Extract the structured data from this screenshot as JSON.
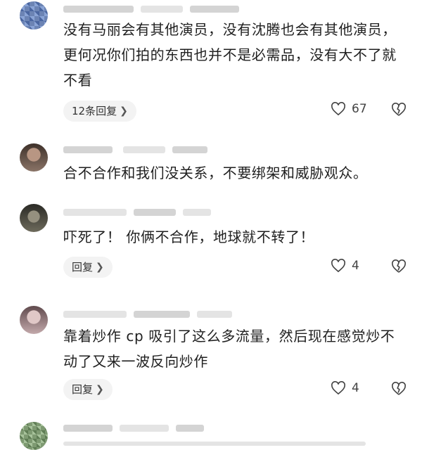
{
  "comments": [
    {
      "text": "没有马丽会有其他演员，没有沈腾也会有其他演员，更何况你们拍的东西也并不是必需品，没有大不了就不看",
      "reply_label": "12条回复",
      "likes": "67"
    },
    {
      "text": "合不合作和我们没关系，不要绑架和威胁观众。"
    },
    {
      "text": "吓死了！ 你俩不合作，地球就不转了！",
      "reply_label": "回复",
      "likes": "4"
    },
    {
      "text": "靠着炒作 cp 吸引了这么多流量，然后现在感觉炒不动了又来一波反向炒作",
      "reply_label": "回复",
      "likes": "4"
    }
  ],
  "icons": {
    "chevron": "chevron-right-icon",
    "like": "heart-outline-icon",
    "dislike": "broken-heart-icon"
  }
}
